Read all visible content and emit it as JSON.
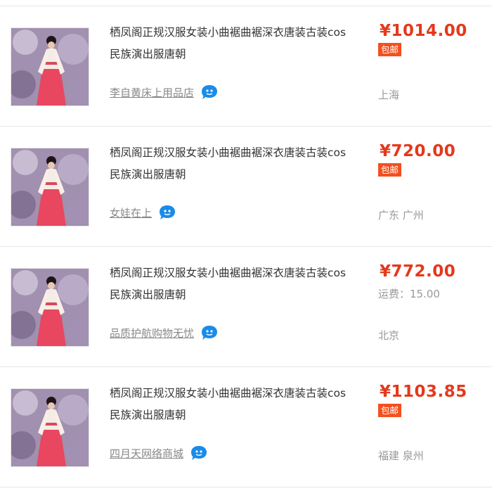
{
  "products": [
    {
      "title": "栖凤阁正规汉服女装小曲裾曲裾深衣唐装古装cos民族演出服唐朝",
      "shop": "李自黄床上用品店",
      "price": "¥1014.00",
      "badge": "包邮",
      "shipping": "",
      "location": "上海"
    },
    {
      "title": "栖凤阁正规汉服女装小曲裾曲裾深衣唐装古装cos民族演出服唐朝",
      "shop": "女娃在上",
      "price": "¥720.00",
      "badge": "包邮",
      "shipping": "",
      "location": "广东 广州"
    },
    {
      "title": "栖凤阁正规汉服女装小曲裾曲裾深衣唐装古装cos民族演出服唐朝",
      "shop": "品质护航购物无忧",
      "price": "¥772.00",
      "badge": "",
      "shipping": "运费：15.00",
      "location": "北京"
    },
    {
      "title": "栖凤阁正规汉服女装小曲裾曲裾深衣唐装古装cos民族演出服唐朝",
      "shop": "四月天网络商城",
      "price": "¥1103.85",
      "badge": "包邮",
      "shipping": "",
      "location": "福建 泉州"
    }
  ],
  "icons": {
    "chat": "wangwang-chat-icon",
    "thumbnail": "product-thumbnail-image"
  },
  "colors": {
    "price": "#e4391b",
    "badge_bg": "#f4501e",
    "chat_icon": "#1a8be8",
    "muted_text": "#999999"
  }
}
